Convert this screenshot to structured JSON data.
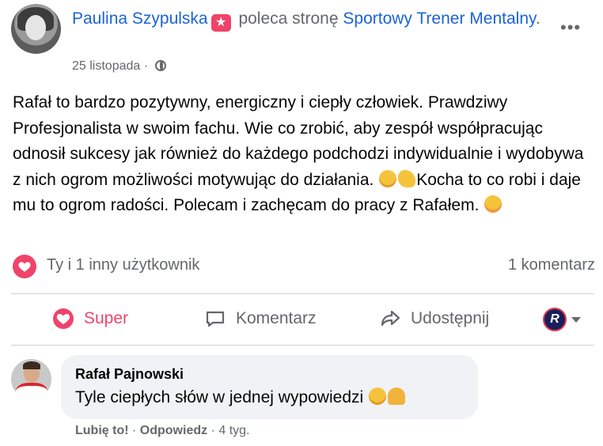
{
  "post": {
    "author": "Paulina Szypulska",
    "recommends_text": "poleca stronę",
    "page_name": "Sportowy Trener Mentalny",
    "page_suffix": ".",
    "date": "25 listopada",
    "separator": "·",
    "more_label": "•••",
    "body_1": "Rafał to bardzo pozytywny, energiczny i ciepły człowiek. Prawdziwy Profesjonalista w swoim fachu. Wie co zrobić, aby zespół współpracując odnosił sukcesy jak również do każdego podchodzi indywidualnie i wydobywa z nich ogrom możliwości motywując do działania. ",
    "body_2": "Kocha to co robi i daje mu to ogrom radości. Polecam i zachęcam do pracy z Rafałem. "
  },
  "reactions": {
    "summary": "Ty i 1 inny użytkownik",
    "comment_count": "1 komentarz"
  },
  "actions": {
    "super": "Super",
    "comment": "Komentarz",
    "share": "Udostępnij",
    "page_switch_letter": "R"
  },
  "comment": {
    "author": "Rafał Pajnowski",
    "text": "Tyle ciepłych słów w jednej wypowiedzi ",
    "like": "Lubię to!",
    "reply": "Odpowiedz",
    "dot1": "·",
    "dot2": "·",
    "age": "4 tyg."
  },
  "colors": {
    "link": "#1b63d6",
    "super": "#f0436b",
    "muted": "#65676b"
  },
  "icons": [
    "recommend-star-icon",
    "globe-icon",
    "more-icon",
    "heart-reaction-icon",
    "super-heart-icon",
    "comment-icon",
    "share-icon",
    "page-avatar-icon",
    "caret-down-icon",
    "star-struck-emoji",
    "muscle-emoji",
    "hugging-emoji",
    "pray-emoji"
  ]
}
